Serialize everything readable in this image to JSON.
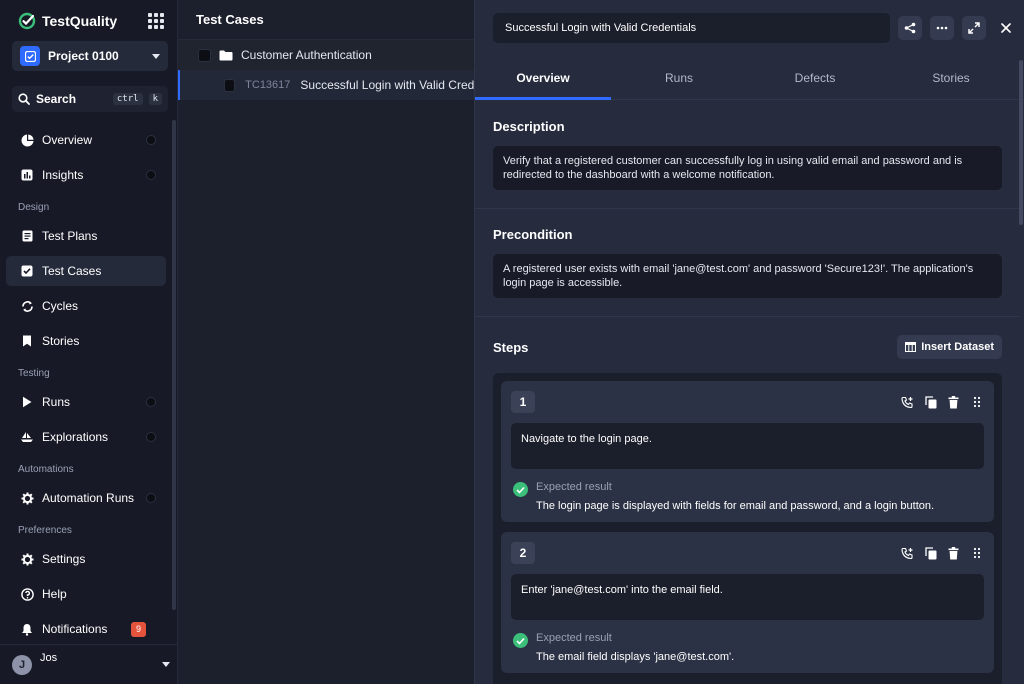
{
  "brand": {
    "name": "TestQuality"
  },
  "project": {
    "name": "Project 0100"
  },
  "search": {
    "label": "Search",
    "shortcut_key1": "ctrl",
    "shortcut_key2": "k"
  },
  "nav": {
    "overview": "Overview",
    "insights": "Insights",
    "section_design": "Design",
    "test_plans": "Test Plans",
    "test_cases": "Test Cases",
    "cycles": "Cycles",
    "stories": "Stories",
    "section_testing": "Testing",
    "runs": "Runs",
    "explorations": "Explorations",
    "section_automations": "Automations",
    "automation_runs": "Automation Runs",
    "section_preferences": "Preferences",
    "settings": "Settings",
    "help": "Help",
    "notifications": "Notifications",
    "notifications_count": "9"
  },
  "user": {
    "initial": "J",
    "name": "Jos"
  },
  "list": {
    "header": "Test Cases",
    "folder": "Customer Authentication",
    "case_id": "TC13617",
    "case_title": "Successful Login with Valid Credentials"
  },
  "panel": {
    "title": "Successful Login with Valid Credentials",
    "tabs": [
      "Overview",
      "Runs",
      "Defects",
      "Stories"
    ],
    "description_title": "Description",
    "description": "Verify that a registered customer can successfully log in using valid email and password and is redirected to the dashboard with a welcome notification.",
    "precondition_title": "Precondition",
    "precondition": "A registered user exists with email 'jane@test.com' and password 'Secure123!'. The application's login page is accessible.",
    "steps_title": "Steps",
    "insert_dataset": "Insert Dataset",
    "expected_label": "Expected result",
    "steps": [
      {
        "number": "1",
        "action": "Navigate to the login page.",
        "expected": "The login page is displayed with fields for email and password, and a login button."
      },
      {
        "number": "2",
        "action": "Enter 'jane@test.com' into the email field.",
        "expected": "The email field displays 'jane@test.com'."
      }
    ]
  },
  "colors": {
    "accent": "#2f6bff",
    "success": "#3bbf7a",
    "badge": "#e5533c"
  }
}
